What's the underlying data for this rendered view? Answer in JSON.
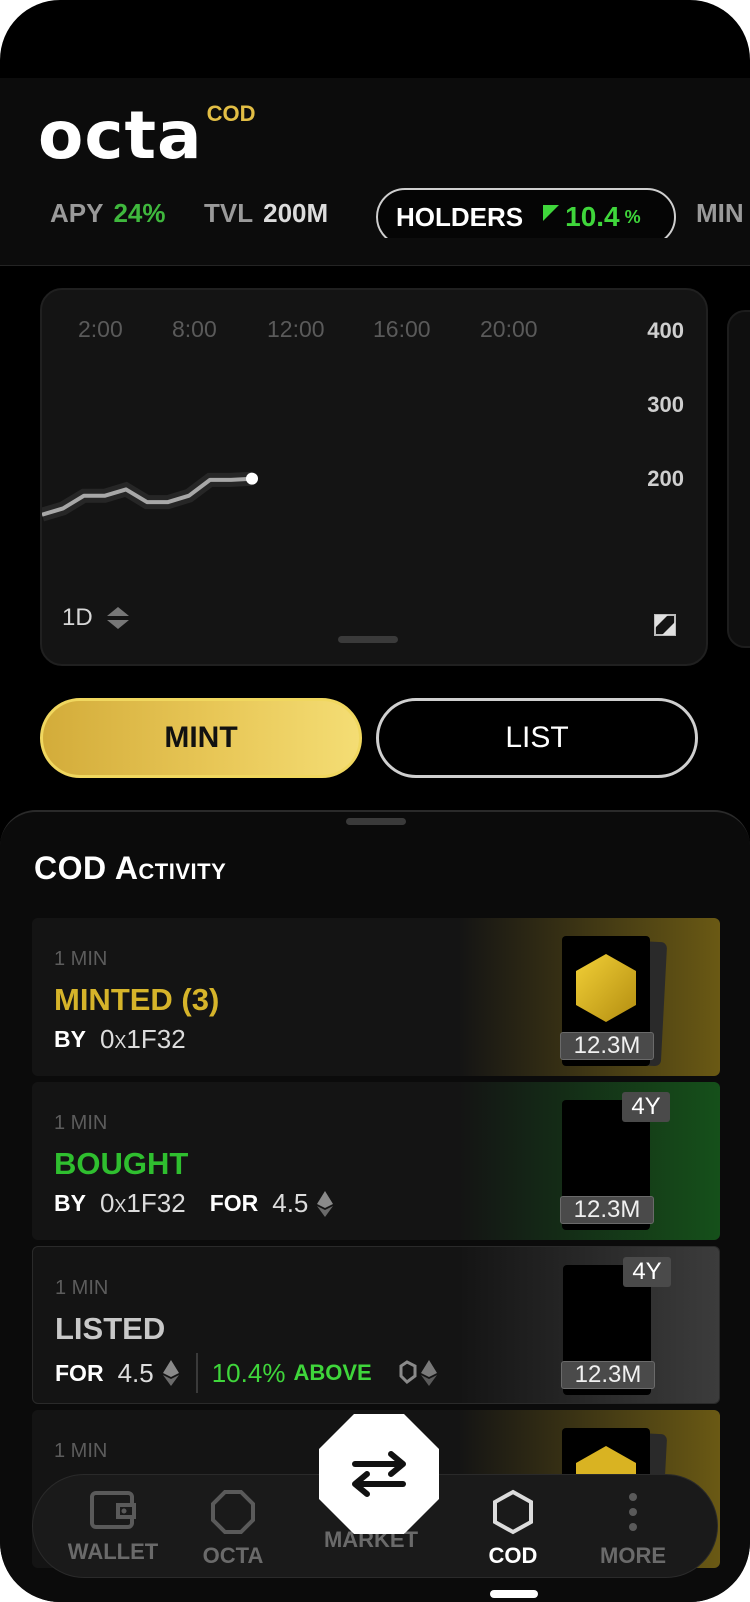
{
  "header": {
    "logo_text": "octa",
    "logo_sup": "COD"
  },
  "ticker": [
    {
      "key": "APY",
      "value": "24%"
    },
    {
      "key": "TVL",
      "value": "200M"
    },
    {
      "key": "HOLDERS",
      "value": "10.4",
      "unit": "%"
    },
    {
      "key": "MIN",
      "value": ""
    }
  ],
  "chart": {
    "x_labels": [
      "2:00",
      "8:00",
      "12:00",
      "16:00",
      "20:00"
    ],
    "y_labels": [
      "400",
      "300",
      "200"
    ],
    "range": "1D"
  },
  "chart_data": {
    "type": "line",
    "x": [
      "",
      "",
      "",
      "",
      "",
      "",
      "",
      "",
      "",
      "",
      ""
    ],
    "values": [
      140,
      150,
      170,
      170,
      180,
      160,
      160,
      170,
      195,
      195,
      197
    ],
    "ylim": [
      100,
      440
    ]
  },
  "actions": {
    "mint": "MINT",
    "list": "LIST"
  },
  "activity": {
    "title": "COD Activity",
    "items": [
      {
        "time": "1 MIN",
        "title": "MINTED (3)",
        "by_label": "BY",
        "by": "0x1F32",
        "badge": "12.3M",
        "accent": "#c9a421"
      },
      {
        "time": "1 MIN",
        "title": "BOUGHT",
        "by_label": "BY",
        "by": "0x1F32",
        "for_label": "FOR",
        "for": "4.5",
        "badge": "12.3M",
        "age": "4Y",
        "accent": "#2fbf2f"
      },
      {
        "time": "1 MIN",
        "title": "LISTED",
        "for_label": "FOR",
        "for": "4.5",
        "delta": "10.4%",
        "delta_label": "ABOVE",
        "badge": "12.3M",
        "age": "4Y",
        "accent": "#bdbdbd"
      },
      {
        "time": "1 MIN"
      }
    ]
  },
  "nav": {
    "items": [
      {
        "label": "WALLET"
      },
      {
        "label": "OCTA"
      },
      {
        "label": "MARKET"
      },
      {
        "label": "COD"
      },
      {
        "label": "MORE"
      }
    ]
  },
  "colors": {
    "gold": "#e2be45",
    "green": "#3fd63b",
    "bg": "#000000"
  }
}
